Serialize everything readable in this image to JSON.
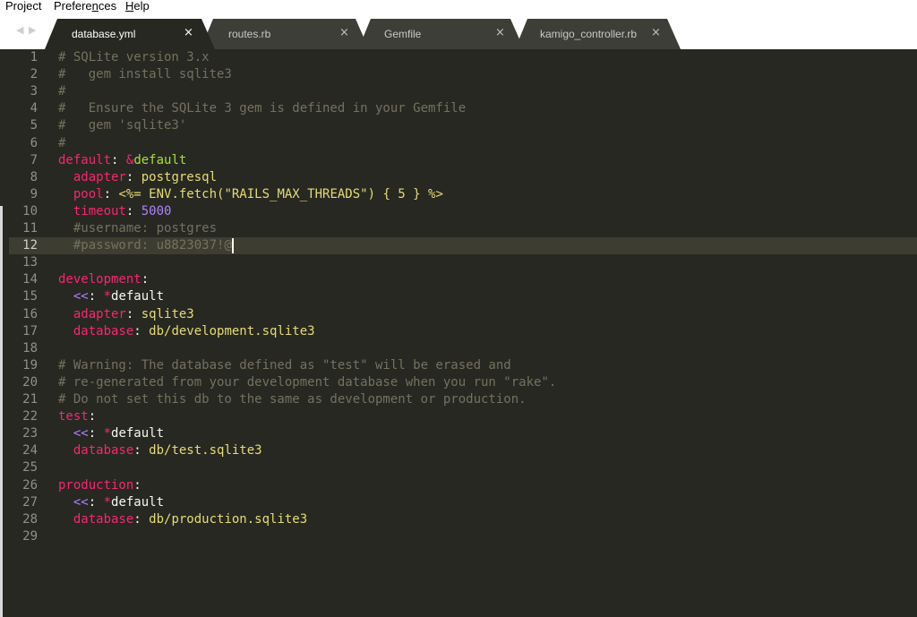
{
  "menu": {
    "project": "Project",
    "preferences_pre": "Prefere",
    "preferences_u": "n",
    "preferences_post": "ces",
    "help_u": "H",
    "help_post": "elp"
  },
  "nav": {
    "back_icon": "triangle-left",
    "forward_icon": "triangle-right",
    "back_glyph": "◀",
    "forward_glyph": "▶"
  },
  "tabs": [
    {
      "label": "database.yml",
      "close": "×",
      "active": true
    },
    {
      "label": "routes.rb",
      "close": "×",
      "active": false
    },
    {
      "label": "Gemfile",
      "close": "×",
      "active": false
    },
    {
      "label": "kamigo_controller.rb",
      "close": "×",
      "active": false
    }
  ],
  "editor": {
    "current_line": 12,
    "theme_colors": {
      "background": "#272822",
      "comment": "#75715e",
      "key": "#f92672",
      "string": "#e6db74",
      "anchor": "#a6e22e",
      "number": "#ae81ff"
    },
    "line_numbers": [
      "1",
      "2",
      "3",
      "4",
      "5",
      "6",
      "7",
      "8",
      "9",
      "10",
      "11",
      "12",
      "13",
      "14",
      "15",
      "16",
      "17",
      "18",
      "19",
      "20",
      "21",
      "22",
      "23",
      "24",
      "25",
      "26",
      "27",
      "28",
      "29"
    ],
    "lines": [
      [
        {
          "t": "cm",
          "v": "# SQLite version 3.x"
        }
      ],
      [
        {
          "t": "cm",
          "v": "#   gem install sqlite3"
        }
      ],
      [
        {
          "t": "cm",
          "v": "#"
        }
      ],
      [
        {
          "t": "cm",
          "v": "#   Ensure the SQLite 3 gem is defined in your Gemfile"
        }
      ],
      [
        {
          "t": "cm",
          "v": "#   gem 'sqlite3'"
        }
      ],
      [
        {
          "t": "cm",
          "v": "#"
        }
      ],
      [
        {
          "t": "key",
          "v": "default"
        },
        {
          "t": "punct",
          "v": ": "
        },
        {
          "t": "alias",
          "v": "&"
        },
        {
          "t": "anchor",
          "v": "default"
        }
      ],
      [
        {
          "t": "plain",
          "v": "  "
        },
        {
          "t": "key",
          "v": "adapter"
        },
        {
          "t": "punct",
          "v": ": "
        },
        {
          "t": "str",
          "v": "postgresql"
        }
      ],
      [
        {
          "t": "plain",
          "v": "  "
        },
        {
          "t": "key",
          "v": "pool"
        },
        {
          "t": "punct",
          "v": ": "
        },
        {
          "t": "str",
          "v": "<%= ENV.fetch(\"RAILS_MAX_THREADS\") { 5 } %>"
        }
      ],
      [
        {
          "t": "plain",
          "v": "  "
        },
        {
          "t": "key",
          "v": "timeout"
        },
        {
          "t": "punct",
          "v": ": "
        },
        {
          "t": "num",
          "v": "5000"
        }
      ],
      [
        {
          "t": "plain",
          "v": "  "
        },
        {
          "t": "cm",
          "v": "#username: postgres"
        }
      ],
      [
        {
          "t": "plain",
          "v": "  "
        },
        {
          "t": "cm",
          "v": "#password: u8823037!@"
        }
      ],
      [],
      [
        {
          "t": "key",
          "v": "development"
        },
        {
          "t": "punct",
          "v": ":"
        }
      ],
      [
        {
          "t": "plain",
          "v": "  "
        },
        {
          "t": "mergekey",
          "v": "<<"
        },
        {
          "t": "punct",
          "v": ": "
        },
        {
          "t": "alias",
          "v": "*"
        },
        {
          "t": "plain",
          "v": "default"
        }
      ],
      [
        {
          "t": "plain",
          "v": "  "
        },
        {
          "t": "key",
          "v": "adapter"
        },
        {
          "t": "punct",
          "v": ": "
        },
        {
          "t": "str",
          "v": "sqlite3"
        }
      ],
      [
        {
          "t": "plain",
          "v": "  "
        },
        {
          "t": "key",
          "v": "database"
        },
        {
          "t": "punct",
          "v": ": "
        },
        {
          "t": "str",
          "v": "db/development.sqlite3"
        }
      ],
      [],
      [
        {
          "t": "cm",
          "v": "# Warning: The database defined as \"test\" will be erased and"
        }
      ],
      [
        {
          "t": "cm",
          "v": "# re-generated from your development database when you run \"rake\"."
        }
      ],
      [
        {
          "t": "cm",
          "v": "# Do not set this db to the same as development or production."
        }
      ],
      [
        {
          "t": "key",
          "v": "test"
        },
        {
          "t": "punct",
          "v": ":"
        }
      ],
      [
        {
          "t": "plain",
          "v": "  "
        },
        {
          "t": "mergekey",
          "v": "<<"
        },
        {
          "t": "punct",
          "v": ": "
        },
        {
          "t": "alias",
          "v": "*"
        },
        {
          "t": "plain",
          "v": "default"
        }
      ],
      [
        {
          "t": "plain",
          "v": "  "
        },
        {
          "t": "key",
          "v": "database"
        },
        {
          "t": "punct",
          "v": ": "
        },
        {
          "t": "str",
          "v": "db/test.sqlite3"
        }
      ],
      [],
      [
        {
          "t": "key",
          "v": "production"
        },
        {
          "t": "punct",
          "v": ":"
        }
      ],
      [
        {
          "t": "plain",
          "v": "  "
        },
        {
          "t": "mergekey",
          "v": "<<"
        },
        {
          "t": "punct",
          "v": ": "
        },
        {
          "t": "alias",
          "v": "*"
        },
        {
          "t": "plain",
          "v": "default"
        }
      ],
      [
        {
          "t": "plain",
          "v": "  "
        },
        {
          "t": "key",
          "v": "database"
        },
        {
          "t": "punct",
          "v": ": "
        },
        {
          "t": "str",
          "v": "db/production.sqlite3"
        }
      ],
      []
    ]
  }
}
